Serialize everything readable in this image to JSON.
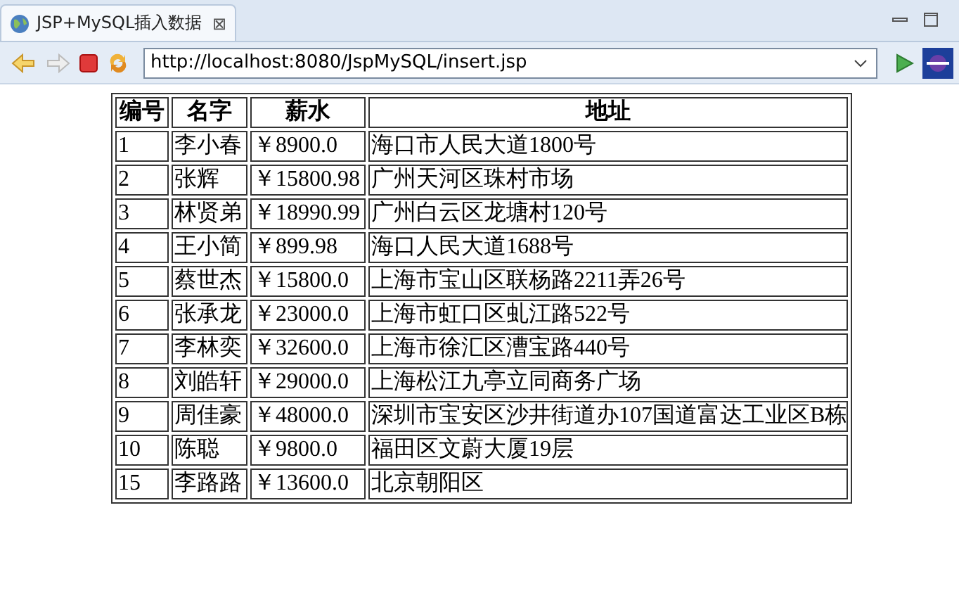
{
  "tab": {
    "title": "JSP+MySQL插入数据",
    "close": "⊠"
  },
  "toolbar": {
    "url": "http://localhost:8080/JspMySQL/insert.jsp"
  },
  "table": {
    "columns": [
      "编号",
      "名字",
      "薪水",
      "地址"
    ],
    "rows": [
      [
        "1",
        "李小春",
        "￥8900.0",
        "海口市人民大道1800号"
      ],
      [
        "2",
        "张辉",
        "￥15800.98",
        "广州天河区珠村市场"
      ],
      [
        "3",
        "林贤弟",
        "￥18990.99",
        "广州白云区龙塘村120号"
      ],
      [
        "4",
        "王小简",
        "￥899.98",
        "海口人民大道1688号"
      ],
      [
        "5",
        "蔡世杰",
        "￥15800.0",
        "上海市宝山区联杨路2211弄26号"
      ],
      [
        "6",
        "张承龙",
        "￥23000.0",
        "上海市虹口区虬江路522号"
      ],
      [
        "7",
        "李林奕",
        "￥32600.0",
        "上海市徐汇区漕宝路440号"
      ],
      [
        "8",
        "刘皓轩",
        "￥29000.0",
        "上海松江九亭立同商务广场"
      ],
      [
        "9",
        "周佳豪",
        "￥48000.0",
        "深圳市宝安区沙井街道办107国道富达工业区B栋"
      ],
      [
        "10",
        "陈聪",
        "￥9800.0",
        "福田区文蔚大厦19层"
      ],
      [
        "15",
        "李路路",
        "￥13600.0",
        "北京朝阳区"
      ]
    ]
  }
}
